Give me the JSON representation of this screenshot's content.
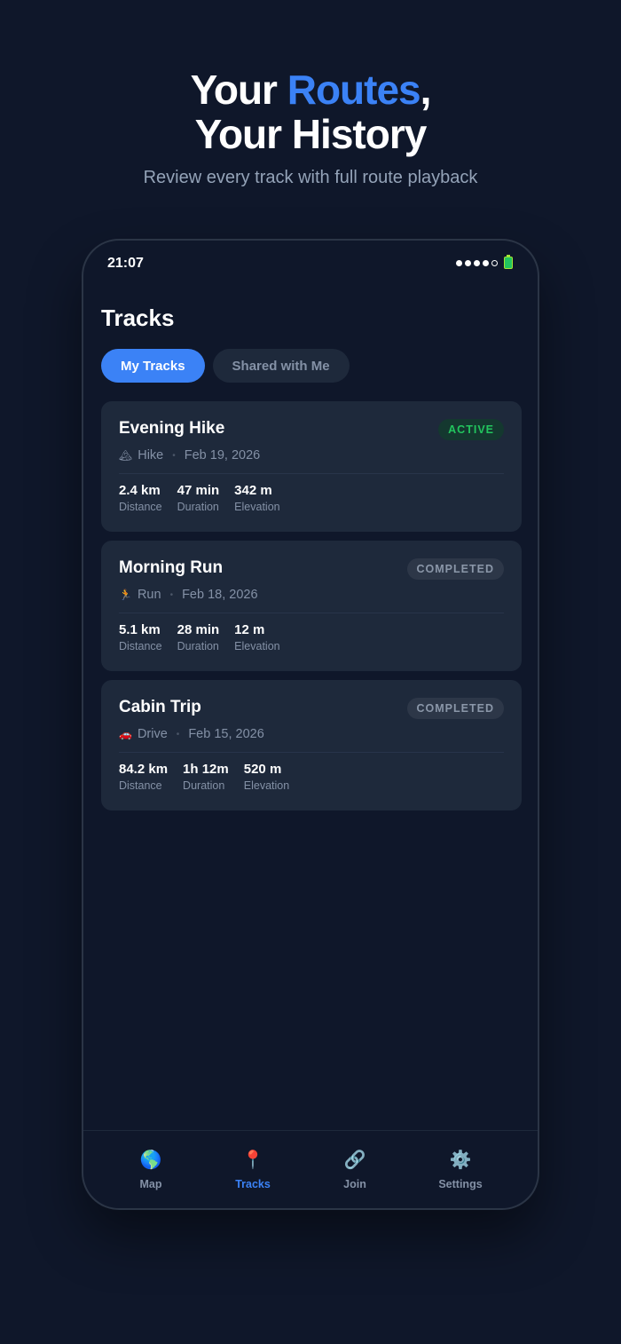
{
  "hero": {
    "title_part1": "Your ",
    "title_accent": "Routes",
    "title_part2": ",",
    "title_line2": "Your History",
    "subtitle": "Review every track with full route playback"
  },
  "status_bar": {
    "time": "21:07"
  },
  "screen": {
    "title": "Tracks"
  },
  "tabs": [
    {
      "label": "My Tracks",
      "active": true
    },
    {
      "label": "Shared with Me",
      "active": false
    }
  ],
  "tracks": [
    {
      "name": "Evening Hike",
      "status": "ACTIVE",
      "type_icon": "🏔",
      "type": "Hike",
      "date": "Feb 19, 2026",
      "stats": [
        {
          "value": "2.4 km",
          "label": "Distance"
        },
        {
          "value": "47 min",
          "label": "Duration"
        },
        {
          "value": "342 m",
          "label": "Elevation"
        }
      ]
    },
    {
      "name": "Morning Run",
      "status": "COMPLETED",
      "type_icon": "🏃",
      "type": "Run",
      "date": "Feb 18, 2026",
      "stats": [
        {
          "value": "5.1 km",
          "label": "Distance"
        },
        {
          "value": "28 min",
          "label": "Duration"
        },
        {
          "value": "12 m",
          "label": "Elevation"
        }
      ]
    },
    {
      "name": "Cabin Trip",
      "status": "COMPLETED",
      "type_icon": "🚗",
      "type": "Drive",
      "date": "Feb 15, 2026",
      "stats": [
        {
          "value": "84.2 km",
          "label": "Distance"
        },
        {
          "value": "1h 12m",
          "label": "Duration"
        },
        {
          "value": "520 m",
          "label": "Elevation"
        }
      ]
    }
  ],
  "meta_separator": "•",
  "nav": [
    {
      "label": "Map",
      "icon": "🌎",
      "active": false
    },
    {
      "label": "Tracks",
      "icon": "📍",
      "active": true
    },
    {
      "label": "Join",
      "icon": "🔗",
      "active": false
    },
    {
      "label": "Settings",
      "icon": "⚙️",
      "active": false
    }
  ],
  "colors": {
    "background": "#0f172a",
    "card": "#1e293b",
    "accent": "#3b82f6",
    "active_green": "#22c55e",
    "muted": "#8491a6"
  }
}
